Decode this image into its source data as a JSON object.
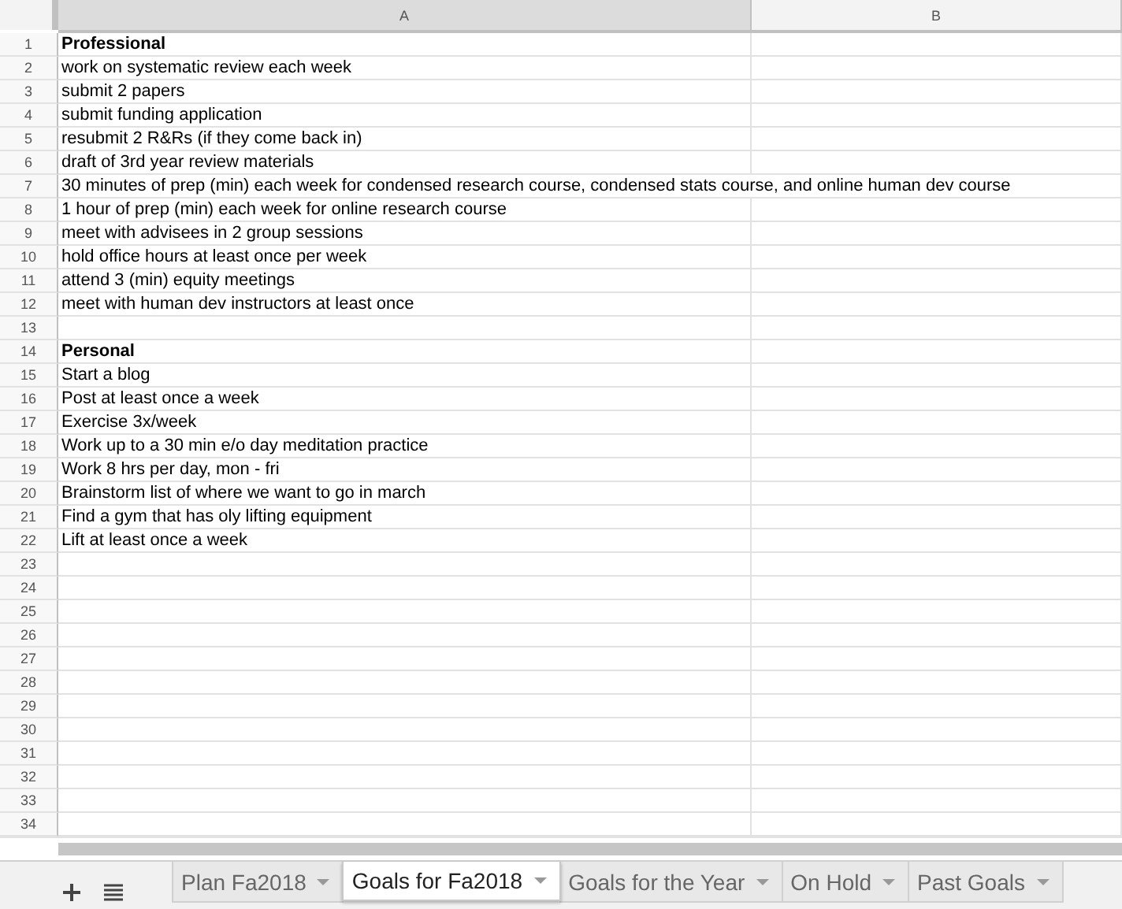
{
  "columns": [
    {
      "label": "A",
      "selected": true
    },
    {
      "label": "B",
      "selected": false
    }
  ],
  "rows": [
    {
      "number": "1",
      "kind": "heading",
      "a": "Professional"
    },
    {
      "number": "2",
      "kind": "item",
      "a": "work on systematic review each week"
    },
    {
      "number": "3",
      "kind": "item",
      "a": "submit 2 papers"
    },
    {
      "number": "4",
      "kind": "item",
      "a": "submit funding application"
    },
    {
      "number": "5",
      "kind": "item",
      "a": "resubmit 2 R&Rs (if they come back in)"
    },
    {
      "number": "6",
      "kind": "item",
      "a": "draft of 3rd year review materials"
    },
    {
      "number": "7",
      "kind": "item",
      "a": "30 minutes of prep (min) each week for condensed research course, condensed stats course, and online human dev course"
    },
    {
      "number": "8",
      "kind": "item",
      "a": "1 hour of prep (min) each week for online research course"
    },
    {
      "number": "9",
      "kind": "item",
      "a": "meet with advisees in 2 group sessions"
    },
    {
      "number": "10",
      "kind": "item",
      "a": "hold office hours at least once per week"
    },
    {
      "number": "11",
      "kind": "item",
      "a": "attend 3 (min) equity meetings"
    },
    {
      "number": "12",
      "kind": "item",
      "a": "meet with human dev instructors at least once"
    },
    {
      "number": "13",
      "kind": "empty"
    },
    {
      "number": "14",
      "kind": "heading",
      "a": "Personal"
    },
    {
      "number": "15",
      "kind": "item",
      "a": "Start a blog"
    },
    {
      "number": "16",
      "kind": "item",
      "a": "Post at least once a week"
    },
    {
      "number": "17",
      "kind": "item",
      "a": "Exercise 3x/week"
    },
    {
      "number": "18",
      "kind": "item",
      "a": "Work up to a 30 min e/o day meditation practice"
    },
    {
      "number": "19",
      "kind": "item",
      "a": "Work 8 hrs per day, mon - fri"
    },
    {
      "number": "20",
      "kind": "item",
      "a": "Brainstorm list of where we want to go in march"
    },
    {
      "number": "21",
      "kind": "item",
      "a": "Find a gym that has oly lifting equipment"
    },
    {
      "number": "22",
      "kind": "item",
      "a": "Lift at least once a week"
    },
    {
      "number": "23",
      "kind": "empty"
    },
    {
      "number": "24",
      "kind": "empty"
    },
    {
      "number": "25",
      "kind": "empty"
    },
    {
      "number": "26",
      "kind": "empty"
    },
    {
      "number": "27",
      "kind": "empty"
    },
    {
      "number": "28",
      "kind": "empty"
    },
    {
      "number": "29",
      "kind": "empty"
    },
    {
      "number": "30",
      "kind": "empty"
    },
    {
      "number": "31",
      "kind": "empty"
    },
    {
      "number": "32",
      "kind": "empty"
    },
    {
      "number": "33",
      "kind": "empty"
    },
    {
      "number": "34",
      "kind": "empty"
    }
  ],
  "sheet_tabs": [
    {
      "label": "Plan Fa2018",
      "selected": false
    },
    {
      "label": "Goals for Fa2018",
      "selected": true
    },
    {
      "label": "Goals for the Year",
      "selected": false
    },
    {
      "label": "On Hold",
      "selected": false
    },
    {
      "label": "Past Goals",
      "selected": false
    }
  ]
}
